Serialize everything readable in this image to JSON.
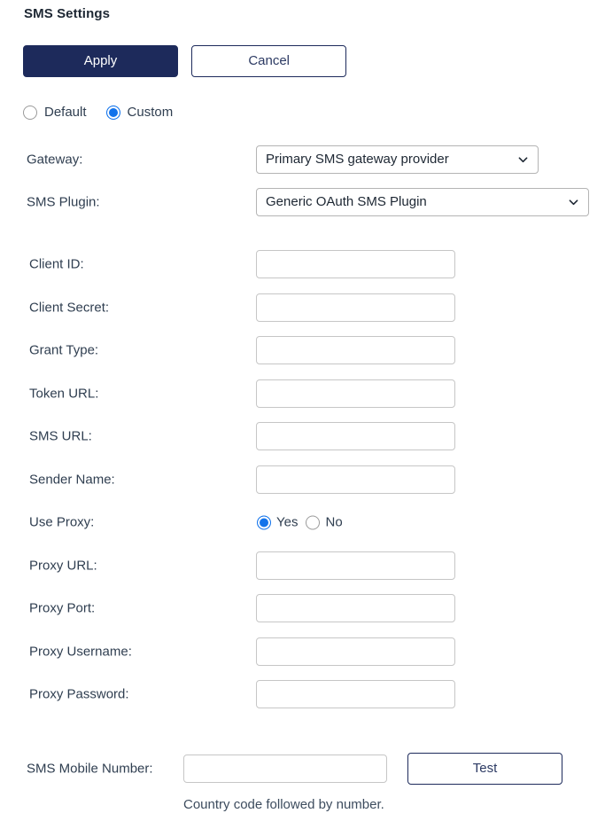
{
  "page": {
    "title": "SMS Settings"
  },
  "toolbar": {
    "apply_label": "Apply",
    "cancel_label": "Cancel"
  },
  "mode": {
    "options": [
      {
        "label": "Default",
        "selected": false
      },
      {
        "label": "Custom",
        "selected": true
      }
    ]
  },
  "selects": {
    "gateway": {
      "label": "Gateway:",
      "value": "Primary SMS gateway provider"
    },
    "sms_plugin": {
      "label": "SMS Plugin:",
      "value": "Generic OAuth SMS Plugin"
    }
  },
  "fields": [
    {
      "label": "Client ID:",
      "value": "",
      "placeholder": ""
    },
    {
      "label": "Client Secret:",
      "value": "",
      "placeholder": ""
    },
    {
      "label": "Grant Type:",
      "value": "",
      "placeholder": ""
    },
    {
      "label": "Token URL:",
      "value": "",
      "placeholder": ""
    },
    {
      "label": "SMS URL:",
      "value": "",
      "placeholder": ""
    },
    {
      "label": "Sender Name:",
      "value": "",
      "placeholder": ""
    }
  ],
  "use_proxy": {
    "label": "Use Proxy:",
    "options": [
      {
        "label": "Yes",
        "selected": true
      },
      {
        "label": "No",
        "selected": false
      }
    ]
  },
  "proxy_fields": [
    {
      "label": "Proxy URL:",
      "value": "",
      "placeholder": ""
    },
    {
      "label": "Proxy Port:",
      "value": "",
      "placeholder": ""
    },
    {
      "label": "Proxy Username:",
      "value": "",
      "placeholder": ""
    },
    {
      "label": "Proxy Password:",
      "value": "",
      "placeholder": ""
    }
  ],
  "test": {
    "label": "SMS Mobile Number:",
    "value": "",
    "placeholder": "",
    "button_label": "Test",
    "hint": "Country code followed by number."
  },
  "colors": {
    "primary": "#1d2a5b",
    "radio_accent": "#1273eb",
    "label_text": "#2f3e50",
    "input_border": "#c6c6c6",
    "select_border": "#b4b4b4"
  },
  "icons": {
    "chevron": "chevron-down-icon"
  }
}
